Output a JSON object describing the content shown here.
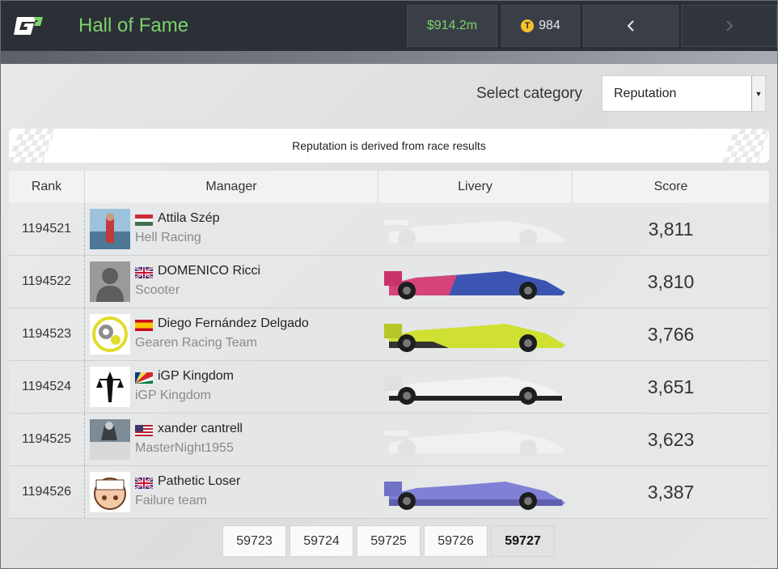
{
  "header": {
    "logo_text": "iGP",
    "title": "Hall of Fame",
    "money": "$914.2m",
    "tokens": "984",
    "token_symbol": "T",
    "prev_icon": "chevron-left-icon",
    "next_icon": "chevron-right-icon"
  },
  "category": {
    "label": "Select category",
    "selected": "Reputation"
  },
  "banner": {
    "text": "Reputation is derived from race results"
  },
  "table": {
    "headers": {
      "rank": "Rank",
      "manager": "Manager",
      "livery": "Livery",
      "score": "Score"
    },
    "rows": [
      {
        "rank": "1194521",
        "name": "Attila Szép",
        "team": "Hell Racing",
        "score": "3,811",
        "country": "Hungary",
        "livery": "white"
      },
      {
        "rank": "1194522",
        "name": "DOMENICO Ricci",
        "team": "Scooter",
        "score": "3,810",
        "country": "United Kingdom",
        "livery": "pink-blue"
      },
      {
        "rank": "1194523",
        "name": "Diego Fernández Delgado",
        "team": "Gearen Racing Team",
        "score": "3,766",
        "country": "Spain",
        "livery": "lime"
      },
      {
        "rank": "1194524",
        "name": "iGP Kingdom",
        "team": "iGP Kingdom",
        "score": "3,651",
        "country": "Seychelles",
        "livery": "white-black"
      },
      {
        "rank": "1194525",
        "name": "xander cantrell",
        "team": "MasterNight1955",
        "score": "3,623",
        "country": "United States",
        "livery": "white"
      },
      {
        "rank": "1194526",
        "name": "Pathetic Loser",
        "team": "Failure team",
        "score": "3,387",
        "country": "United Kingdom",
        "livery": "purple"
      }
    ]
  },
  "pagination": {
    "pages": [
      "59723",
      "59724",
      "59725",
      "59726",
      "59727"
    ],
    "current": "59727"
  },
  "colors": {
    "accent_green": "#7dd36b",
    "topbar": "#2b2f36"
  }
}
